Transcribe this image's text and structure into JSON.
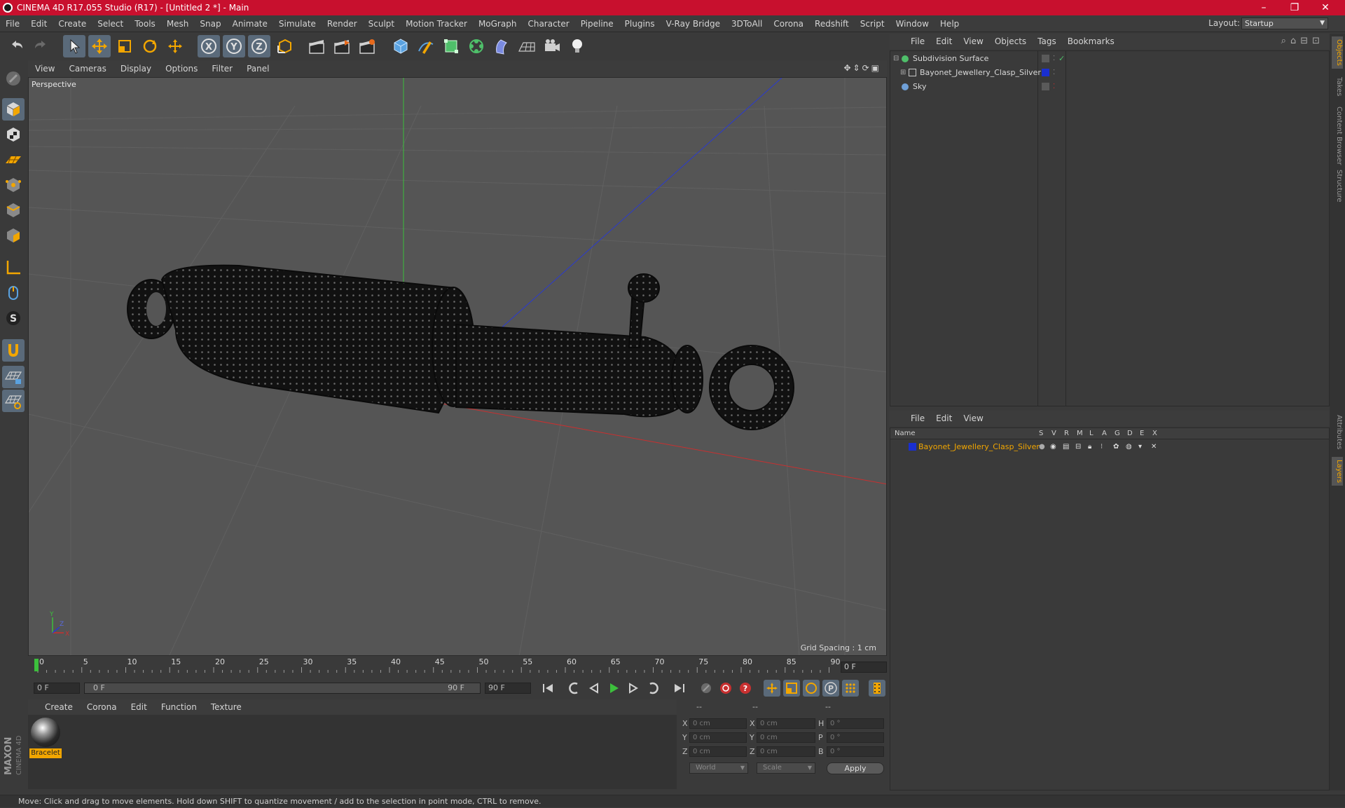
{
  "window": {
    "title": "CINEMA 4D R17.055 Studio (R17) - [Untitled 2 *] - Main",
    "minimize": "–",
    "restore": "❐",
    "close": "✕"
  },
  "menubar": {
    "items": [
      "File",
      "Edit",
      "Create",
      "Select",
      "Tools",
      "Mesh",
      "Snap",
      "Animate",
      "Simulate",
      "Render",
      "Sculpt",
      "Motion Tracker",
      "MoGraph",
      "Character",
      "Pipeline",
      "Plugins",
      "V-Ray Bridge",
      "3DToAll",
      "Corona",
      "Redshift",
      "Script",
      "Window",
      "Help"
    ],
    "layout_label": "Layout:",
    "layout_value": "Startup"
  },
  "viewport": {
    "menu": [
      "View",
      "Cameras",
      "Display",
      "Options",
      "Filter",
      "Panel"
    ],
    "label": "Perspective",
    "grid_spacing": "Grid Spacing : 1 cm"
  },
  "timeline": {
    "ticks": [
      "0",
      "5",
      "10",
      "15",
      "20",
      "25",
      "30",
      "35",
      "40",
      "45",
      "50",
      "55",
      "60",
      "65",
      "70",
      "75",
      "80",
      "85",
      "90"
    ],
    "current_frame": "0 F",
    "start_field": "0 F",
    "range_start": "0 F",
    "range_end": "90 F",
    "end_field": "90 F"
  },
  "material_manager": {
    "menu": [
      "Create",
      "Corona",
      "Edit",
      "Function",
      "Texture"
    ],
    "materials": [
      {
        "name": "Bracelet"
      }
    ]
  },
  "coordinates": {
    "header_left": "--",
    "header_mid": "--",
    "header_right": "--",
    "rows": [
      {
        "axis": "X",
        "pos": "0 cm",
        "axis2": "X",
        "size": "0 cm",
        "rot_label": "H",
        "rot": "0 °"
      },
      {
        "axis": "Y",
        "pos": "0 cm",
        "axis2": "Y",
        "size": "0 cm",
        "rot_label": "P",
        "rot": "0 °"
      },
      {
        "axis": "Z",
        "pos": "0 cm",
        "axis2": "Z",
        "size": "0 cm",
        "rot_label": "B",
        "rot": "0 °"
      }
    ],
    "mode1": "World",
    "mode2": "Scale",
    "apply": "Apply"
  },
  "object_manager": {
    "menu": [
      "File",
      "Edit",
      "View",
      "Objects",
      "Tags",
      "Bookmarks"
    ],
    "objects": [
      {
        "name": "Subdivision Surface",
        "color": "#4fbf6a"
      },
      {
        "name": "Bayonet_Jewellery_Clasp_Silver",
        "color": "#c8c8c8"
      },
      {
        "name": "Sky",
        "color": "#6fa0d8"
      }
    ]
  },
  "layer_manager": {
    "menu": [
      "File",
      "Edit",
      "View"
    ],
    "columns": [
      "Name",
      "S",
      "V",
      "R",
      "M",
      "L",
      "A",
      "G",
      "D",
      "E",
      "X"
    ],
    "layers": [
      {
        "name": "Bayonet_Jewellery_Clasp_Silver",
        "color": "#1a2fd0"
      }
    ]
  },
  "right_tabs": [
    "Objects",
    "Takes",
    "Content Browser",
    "Structure",
    "Attributes",
    "Layers"
  ],
  "status": "Move: Click and drag to move elements. Hold down SHIFT to quantize movement / add to the selection in point mode, CTRL to remove.",
  "brand": "MAXON CINEMA 4D",
  "colors": {
    "title_bar": "#c8102e",
    "accent": "#f2a600",
    "selection": "#5a6a7a"
  }
}
